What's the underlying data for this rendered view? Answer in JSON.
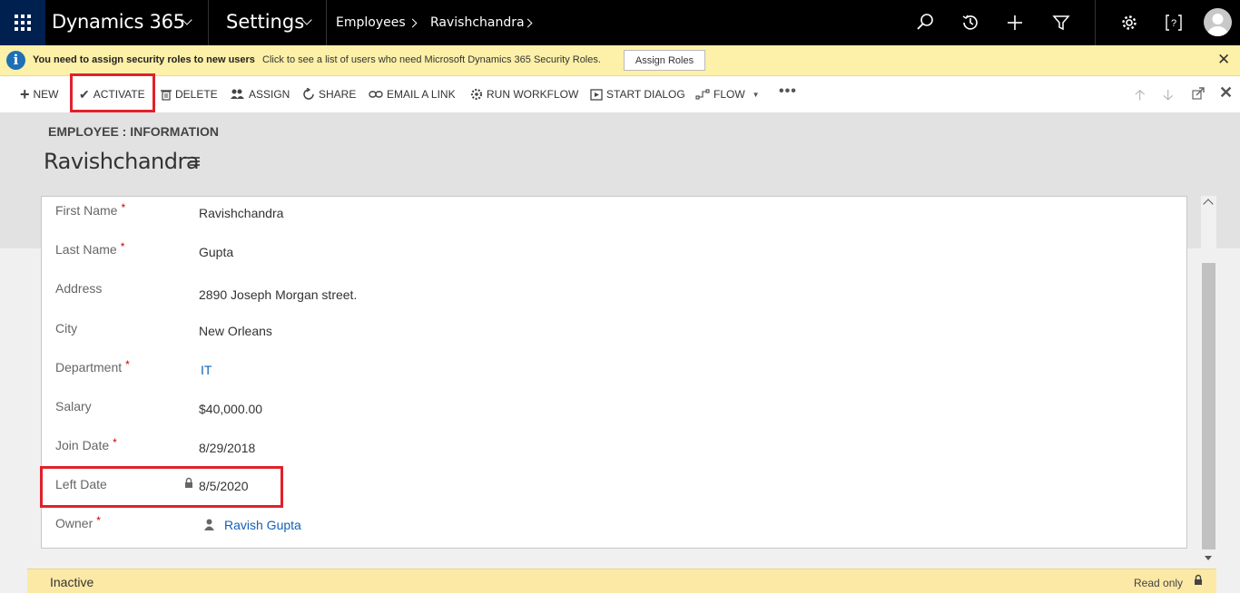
{
  "nav": {
    "app_title": "Dynamics 365",
    "area_title": "Settings",
    "breadcrumb": [
      "Employees",
      "Ravishchandra"
    ]
  },
  "notification": {
    "bold_text": "You need to assign security roles to new users",
    "text": "Click to see a list of users who need Microsoft Dynamics 365 Security Roles.",
    "button_label": "Assign Roles"
  },
  "commands": [
    {
      "label": "NEW",
      "icon": "plus-icon"
    },
    {
      "label": "ACTIVATE",
      "icon": "checkmark-icon"
    },
    {
      "label": "DELETE",
      "icon": "trash-icon"
    },
    {
      "label": "ASSIGN",
      "icon": "assign-icon"
    },
    {
      "label": "SHARE",
      "icon": "share-icon"
    },
    {
      "label": "EMAIL A LINK",
      "icon": "link-icon"
    },
    {
      "label": "RUN WORKFLOW",
      "icon": "workflow-icon"
    },
    {
      "label": "START DIALOG",
      "icon": "dialog-icon"
    },
    {
      "label": "FLOW",
      "icon": "flow-icon"
    }
  ],
  "header": {
    "entity_label": "EMPLOYEE : INFORMATION",
    "record_name": "Ravishchandra"
  },
  "form": {
    "fields": [
      {
        "label": "First Name",
        "required": "*",
        "value": "Ravishchandra"
      },
      {
        "label": "Last Name",
        "required": "*",
        "value": "Gupta"
      },
      {
        "label": "Address",
        "required": "",
        "value": "2890 Joseph Morgan street."
      },
      {
        "label": "City",
        "required": "",
        "value": "New Orleans"
      },
      {
        "label": "Department",
        "required": "*",
        "value": "IT"
      },
      {
        "label": "Salary",
        "required": "",
        "value": "$40,000.00"
      },
      {
        "label": "Join Date",
        "required": "*",
        "value": "8/29/2018"
      },
      {
        "label": "Left Date",
        "required": "",
        "value": "8/5/2020"
      },
      {
        "label": "Owner",
        "required": "*",
        "value": "Ravish Gupta"
      }
    ]
  },
  "footer": {
    "status": "Inactive",
    "read_only": "Read only"
  },
  "colors": {
    "highlight": "#e0212c",
    "link": "#1160b7",
    "notification_bg": "#fdf0a8",
    "nav_bg": "#000000"
  }
}
